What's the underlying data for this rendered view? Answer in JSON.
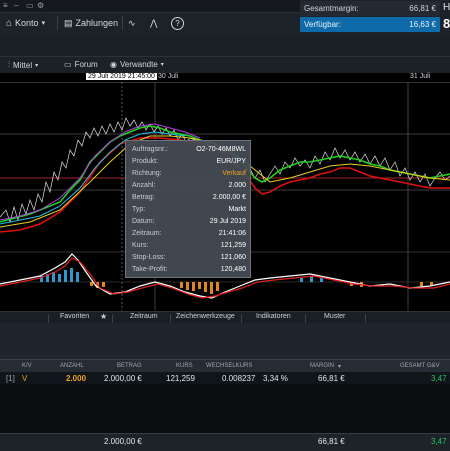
{
  "toolbar": {
    "konto_label": "Konto",
    "zahlungen_label": "Zahlungen"
  },
  "margin": {
    "gesamt_label": "Gesamtmargin:",
    "gesamt_value": "66,81 €",
    "verfuegbar_label": "Verfügbar:",
    "verfuegbar_value": "16,63 €",
    "cut_top": "H",
    "cut_big": "8"
  },
  "subbar": {
    "mittel_label": "Mittel",
    "forum_label": "Forum",
    "verwandte_label": "Verwandte"
  },
  "timeline": {
    "selected_date": "29 Juli 2019 21:45:00",
    "label_30": "30 Juli",
    "label_31": "31 Juli"
  },
  "tooltip": {
    "rows": [
      {
        "k": "Auftragsnr.:",
        "v": "O2-70-46M8WL"
      },
      {
        "k": "Produkt:",
        "v": "EUR/JPY"
      },
      {
        "k": "Richtung:",
        "v": "Verkauf"
      },
      {
        "k": "Anzahl:",
        "v": "2.000"
      },
      {
        "k": "Betrag:",
        "v": "2.000,00 €"
      },
      {
        "k": "Typ:",
        "v": "Markt"
      },
      {
        "k": "Datum:",
        "v": "29 Jul 2019"
      },
      {
        "k": "Zeitraum:",
        "v": "21:41:06"
      },
      {
        "k": "Kurs:",
        "v": "121,259"
      },
      {
        "k": "Stop-Loss:",
        "v": "121,060"
      },
      {
        "k": "Take-Profit:",
        "v": "120,480"
      }
    ]
  },
  "tabs": {
    "favoriten": "Favoriten",
    "zeitraum": "Zeitraum",
    "zeichenwerkzeuge": "Zeichenwerkzeuge",
    "indikatoren": "Indikatoren",
    "muster": "Muster"
  },
  "table": {
    "headers": {
      "kv": "K/V",
      "anzahl": "ANZAHL",
      "betrag": "BETRAG",
      "kurs": "KURS",
      "wechselkurs": "WECHSELKURS",
      "margin": "MARGIN",
      "gesamt": "GESAMT G&V"
    },
    "row": {
      "index": "[1]",
      "kv": "V",
      "anzahl": "2.000",
      "betrag": "2.000,00 €",
      "kurs": "121,259",
      "wechselkurs": "0.008237",
      "pct": "3,34 %",
      "margin": "66,81 €",
      "gesamt": "3,47"
    },
    "footer": {
      "betrag": "2.000,00 €",
      "margin": "66,81 €",
      "gesamt": "3,47"
    }
  },
  "colors": {
    "accent_blue": "#0e6aa8",
    "positive": "#22c55e",
    "sell": "#f0a020"
  }
}
